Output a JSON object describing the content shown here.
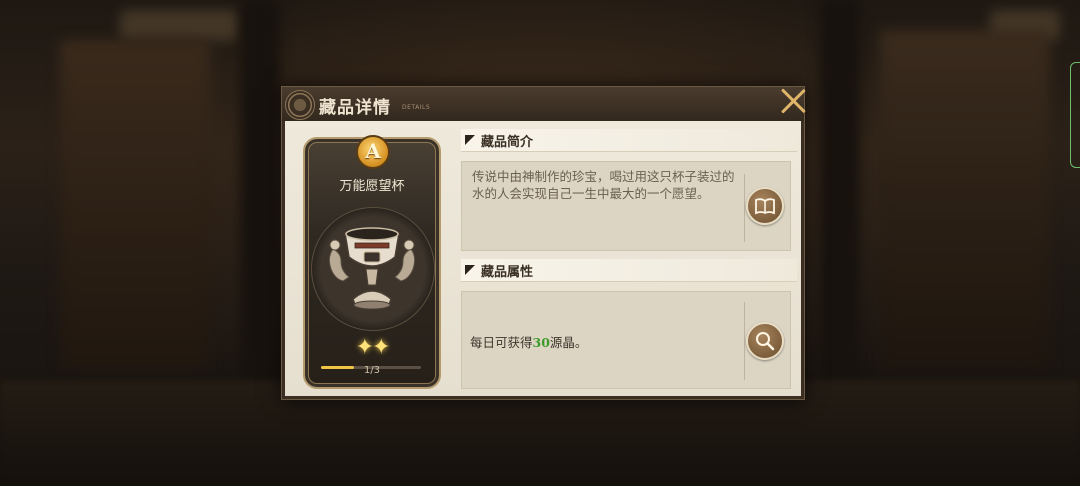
{
  "dialog": {
    "title": "藏品详情",
    "title_sub": "DETAILS",
    "close_icon": "close-icon"
  },
  "card": {
    "rank": "A",
    "name": "万能愿望杯",
    "stars": "✦✦",
    "progress_text": "1/3",
    "progress_fraction": 0.33,
    "item_icon": "golden-cup-icon"
  },
  "intro": {
    "header": "藏品简介",
    "text": "传说中由神制作的珍宝，喝过用这只杯子装过的水的人会实现自己一生中最大的一个愿望。",
    "button_icon": "book-icon"
  },
  "attributes": {
    "header": "藏品属性",
    "text_before": "每日可获得",
    "value": "30",
    "text_after": "源晶。",
    "button_icon": "magnifier-icon"
  },
  "colors": {
    "accent_gold": "#e0b56a",
    "value_green": "#3e9b2a",
    "star_yellow": "#ffe27a"
  }
}
